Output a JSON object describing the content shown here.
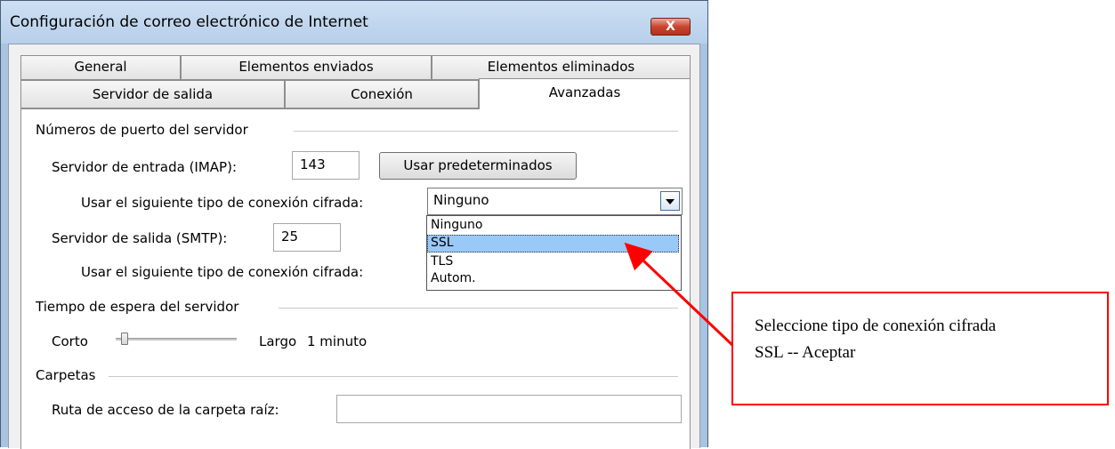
{
  "window": {
    "title": "Configuración de correo electrónico de Internet",
    "close_label": "X"
  },
  "tabs": {
    "row1": [
      "General",
      "Elementos enviados",
      "Elementos eliminados"
    ],
    "row2": [
      "Servidor de salida",
      "Conexión",
      "Avanzadas"
    ],
    "active": "Avanzadas"
  },
  "ports": {
    "group_label": "Números de puerto del servidor",
    "incoming_label": "Servidor de entrada (IMAP):",
    "incoming_value": "143",
    "default_button": "Usar predeterminados",
    "incoming_encryption_label": "Usar el siguiente tipo de conexión cifrada:",
    "incoming_encryption_value": "Ninguno",
    "outgoing_label": "Servidor de salida (SMTP):",
    "outgoing_value": "25",
    "outgoing_encryption_label": "Usar el siguiente tipo de conexión cifrada:"
  },
  "dropdown": {
    "options": [
      "Ninguno",
      "SSL",
      "TLS",
      "Autom."
    ],
    "highlighted": "SSL"
  },
  "timeout": {
    "group_label": "Tiempo de espera del servidor",
    "short_label": "Corto",
    "long_label": "Largo",
    "value_label": "1 minuto",
    "slider_fraction": 0.0
  },
  "folders": {
    "group_label": "Carpetas",
    "root_label": "Ruta de acceso de la carpeta raíz:",
    "root_value": ""
  },
  "annotation": {
    "line1": "Seleccione tipo de conexión cifrada",
    "line2": "SSL -- Aceptar",
    "color": "#ff0000"
  }
}
